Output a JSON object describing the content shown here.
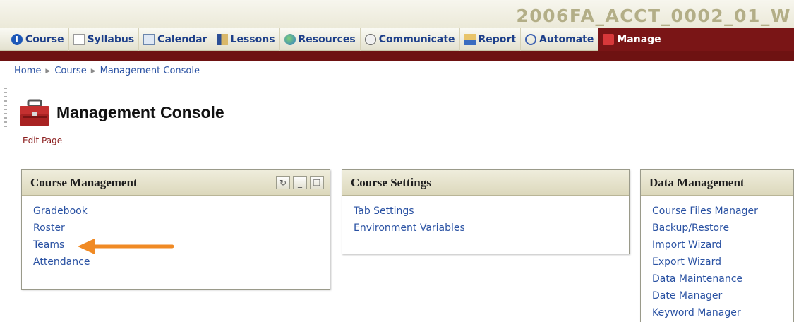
{
  "header": {
    "course_code": "2006FA_ACCT_0002_01_W"
  },
  "nav": {
    "items": [
      {
        "label": "Course",
        "icon": "info-icon"
      },
      {
        "label": "Syllabus",
        "icon": "document-icon"
      },
      {
        "label": "Calendar",
        "icon": "calendar-icon"
      },
      {
        "label": "Lessons",
        "icon": "lessons-icon"
      },
      {
        "label": "Resources",
        "icon": "globe-icon"
      },
      {
        "label": "Communicate",
        "icon": "communicate-icon"
      },
      {
        "label": "Report",
        "icon": "report-icon"
      },
      {
        "label": "Automate",
        "icon": "automate-icon"
      },
      {
        "label": "Manage",
        "icon": "toolbox-icon"
      }
    ],
    "active_item": "Manage"
  },
  "breadcrumb": {
    "items": [
      "Home",
      "Course",
      "Management Console"
    ]
  },
  "page": {
    "title": "Management Console",
    "edit_label": "Edit Page"
  },
  "panels": {
    "course_management": {
      "title": "Course Management",
      "links": [
        "Gradebook",
        "Roster",
        "Teams",
        "Attendance"
      ]
    },
    "course_settings": {
      "title": "Course Settings",
      "links": [
        "Tab Settings",
        "Environment Variables"
      ]
    },
    "data_management": {
      "title": "Data Management",
      "links": [
        "Course Files Manager",
        "Backup/Restore",
        "Import Wizard",
        "Export Wizard",
        "Data Maintenance",
        "Date Manager",
        "Keyword Manager"
      ]
    }
  },
  "colors": {
    "accent_maroon": "#7a1516",
    "link_blue": "#2a52a3",
    "arrow_orange": "#f08a24"
  }
}
